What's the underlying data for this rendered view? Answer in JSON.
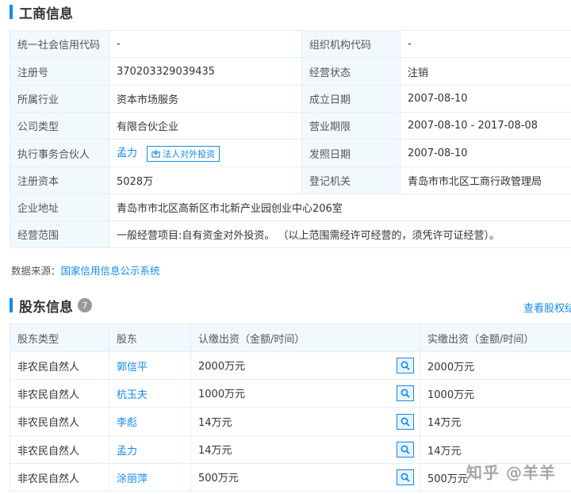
{
  "business": {
    "title": "工商信息",
    "rows": [
      {
        "l1": "统一社会信用代码",
        "v1": "-",
        "l2": "组织机构代码",
        "v2": "-"
      },
      {
        "l1": "注册号",
        "v1": "370203329039435",
        "l2": "经营状态",
        "v2": "注销"
      },
      {
        "l1": "所属行业",
        "v1": "资本市场服务",
        "l2": "成立日期",
        "v2": "2007-08-10"
      },
      {
        "l1": "公司类型",
        "v1": "有限合伙企业",
        "l2": "营业期限",
        "v2": "2007-08-10 - 2017-08-08"
      },
      {
        "l1": "执行事务合伙人",
        "v1": "孟力",
        "chip": "法人对外投资",
        "l2": "发照日期",
        "v2": "2007-08-10"
      },
      {
        "l1": "注册资本",
        "v1": "5028万",
        "l2": "登记机关",
        "v2": "青岛市市北区工商行政管理局"
      },
      {
        "l1": "企业地址",
        "v1": "青岛市市北区高新区市北新产业园创业中心206室"
      },
      {
        "l1": "经营范围",
        "v1": "一般经营项目:自有资金对外投资。 （以上范围需经许可经营的，须凭许可证经营）。"
      }
    ]
  },
  "source": {
    "label": "数据来源：",
    "link": "国家信用信息公示系统"
  },
  "shareholders": {
    "title": "股东信息",
    "count": "7",
    "view_all": "查看股权结构",
    "headers": [
      "股东类型",
      "股东",
      "认缴出资（金额/时间）",
      "实缴出资（金额/时间）"
    ],
    "rows": [
      {
        "type": "非农民自然人",
        "name": "郭信平",
        "subscribed": "2000万元",
        "paid": "2000万元"
      },
      {
        "type": "非农民自然人",
        "name": "杭玉夫",
        "subscribed": "1000万元",
        "paid": "1000万元"
      },
      {
        "type": "非农民自然人",
        "name": "李彪",
        "subscribed": "14万元",
        "paid": "14万元"
      },
      {
        "type": "非农民自然人",
        "name": "孟力",
        "subscribed": "14万元",
        "paid": "14万元"
      },
      {
        "type": "非农民自然人",
        "name": "涂丽萍",
        "subscribed": "500万元",
        "paid": "500万元"
      }
    ]
  },
  "watermark": "知乎 @羊羊",
  "icons": {
    "invest_chip": "download-box-icon",
    "row_action": "search-icon"
  },
  "colors": {
    "accent": "#128bed",
    "label_bg": "#f2f9fc",
    "border": "#e4eef6"
  }
}
